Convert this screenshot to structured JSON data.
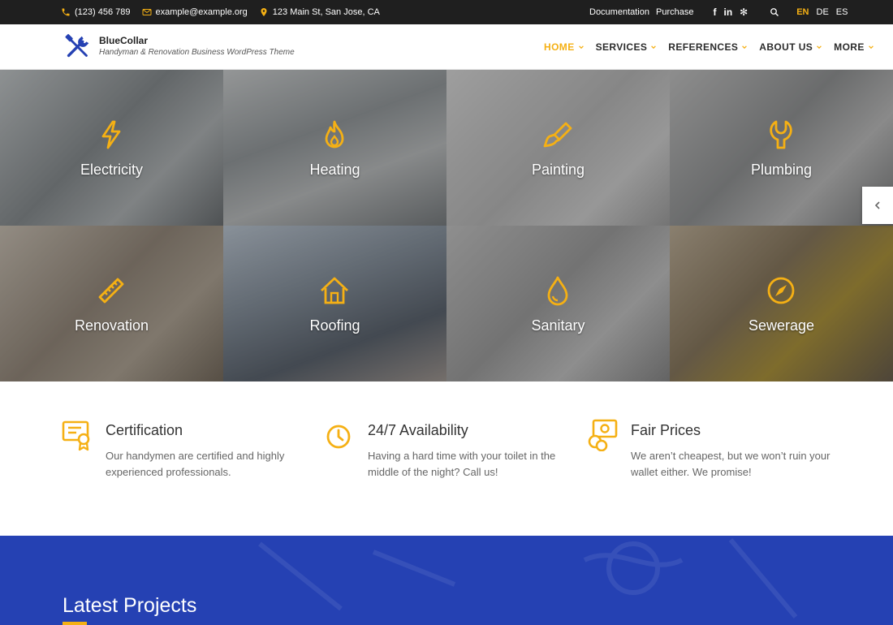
{
  "topbar": {
    "phone": "(123) 456 789",
    "email": "example@example.org",
    "address": "123 Main St, San Jose, CA",
    "documentation": "Documentation",
    "purchase": "Purchase",
    "social": {
      "facebook": "f",
      "linkedin": "in",
      "yelp": "✻"
    },
    "languages": [
      "EN",
      "DE",
      "ES"
    ]
  },
  "header": {
    "brand": "BlueCollar",
    "tagline": "Handyman & Renovation Business WordPress Theme",
    "nav": [
      {
        "label": "HOME"
      },
      {
        "label": "SERVICES"
      },
      {
        "label": "REFERENCES"
      },
      {
        "label": "ABOUT US"
      },
      {
        "label": "MORE"
      }
    ]
  },
  "services": [
    {
      "label": "Electricity",
      "icon": "lightning-icon"
    },
    {
      "label": "Heating",
      "icon": "flame-icon"
    },
    {
      "label": "Painting",
      "icon": "paintbrush-icon"
    },
    {
      "label": "Plumbing",
      "icon": "wrench-icon"
    },
    {
      "label": "Renovation",
      "icon": "ruler-icon"
    },
    {
      "label": "Roofing",
      "icon": "house-icon"
    },
    {
      "label": "Sanitary",
      "icon": "droplet-icon"
    },
    {
      "label": "Sewerage",
      "icon": "compass-icon"
    }
  ],
  "features": [
    {
      "title": "Certification",
      "text": "Our handymen are certified and highly experienced professionals.",
      "icon": "certificate-icon"
    },
    {
      "title": "24/7 Availability",
      "text": "Having a hard time with your toilet in the middle of the night? Call us!",
      "icon": "clock-icon"
    },
    {
      "title": "Fair Prices",
      "text": "We aren’t cheapest, but we won’t ruin your wallet either. We promise!",
      "icon": "money-icon"
    }
  ],
  "projects": {
    "title": "Latest Projects"
  },
  "colors": {
    "accent": "#f5b014",
    "dark": "#1f1f1f",
    "blue": "#2541b3"
  }
}
